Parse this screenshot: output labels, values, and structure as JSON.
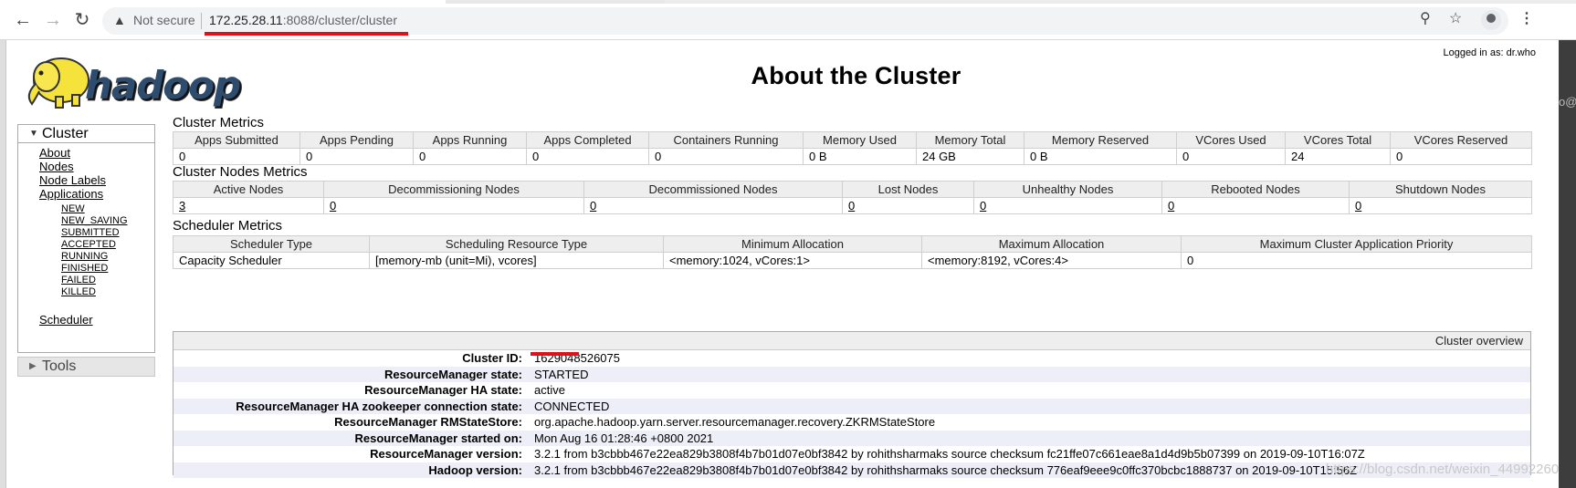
{
  "browser": {
    "security_icon": "warning-triangle-icon",
    "not_secure": "Not secure",
    "url_host": "172.25.28.11",
    "url_rest": ":8088/cluster/cluster"
  },
  "header": {
    "logged_in": "Logged in as: dr.who",
    "title": "About the Cluster",
    "logo_text": "hadoop"
  },
  "side_text": "o@vm",
  "sidebar": {
    "cluster_label": "Cluster",
    "links": [
      "About",
      "Nodes",
      "Node Labels",
      "Applications"
    ],
    "app_states": [
      "NEW",
      "NEW_SAVING",
      "SUBMITTED",
      "ACCEPTED",
      "RUNNING",
      "FINISHED",
      "FAILED",
      "KILLED"
    ],
    "scheduler": "Scheduler",
    "tools_label": "Tools"
  },
  "cluster_metrics": {
    "title": "Cluster Metrics",
    "headers": [
      "Apps Submitted",
      "Apps Pending",
      "Apps Running",
      "Apps Completed",
      "Containers Running",
      "Memory Used",
      "Memory Total",
      "Memory Reserved",
      "VCores Used",
      "VCores Total",
      "VCores Reserved"
    ],
    "values": [
      "0",
      "0",
      "0",
      "0",
      "0",
      "0 B",
      "24 GB",
      "0 B",
      "0",
      "24",
      "0"
    ]
  },
  "node_metrics": {
    "title": "Cluster Nodes Metrics",
    "headers": [
      "Active Nodes",
      "Decommissioning Nodes",
      "Decommissioned Nodes",
      "Lost Nodes",
      "Unhealthy Nodes",
      "Rebooted Nodes",
      "Shutdown Nodes"
    ],
    "values": [
      "3",
      "0",
      "0",
      "0",
      "0",
      "0",
      "0"
    ]
  },
  "scheduler_metrics": {
    "title": "Scheduler Metrics",
    "headers": [
      "Scheduler Type",
      "Scheduling Resource Type",
      "Minimum Allocation",
      "Maximum Allocation",
      "Maximum Cluster Application Priority"
    ],
    "values": [
      "Capacity Scheduler",
      "[memory-mb (unit=Mi), vcores]",
      "<memory:1024, vCores:1>",
      "<memory:8192, vCores:4>",
      "0"
    ]
  },
  "overview": {
    "title": "Cluster overview",
    "rows": [
      {
        "key": "Cluster ID:",
        "value": "1629048526075"
      },
      {
        "key": "ResourceManager state:",
        "value": "STARTED"
      },
      {
        "key": "ResourceManager HA state:",
        "value": "active"
      },
      {
        "key": "ResourceManager HA zookeeper connection state:",
        "value": "CONNECTED"
      },
      {
        "key": "ResourceManager RMStateStore:",
        "value": "org.apache.hadoop.yarn.server.resourcemanager.recovery.ZKRMStateStore"
      },
      {
        "key": "ResourceManager started on:",
        "value": "Mon Aug 16 01:28:46 +0800 2021"
      },
      {
        "key": "ResourceManager version:",
        "value": "3.2.1 from b3cbbb467e22ea829b3808f4b7b01d07e0bf3842 by rohithsharmaks source checksum fc21ffe07c661eae8a1d4d9b5b07399 on 2019-09-10T16:07Z"
      },
      {
        "key": "Hadoop version:",
        "value": "3.2.1 from b3cbbb467e22ea829b3808f4b7b01d07e0bf3842 by rohithsharmaks source checksum 776eaf9eee9c0ffc370bcbc1888737 on 2019-09-10T15:56Z"
      }
    ]
  },
  "watermark": "https://blog.csdn.net/weixin_44992260"
}
